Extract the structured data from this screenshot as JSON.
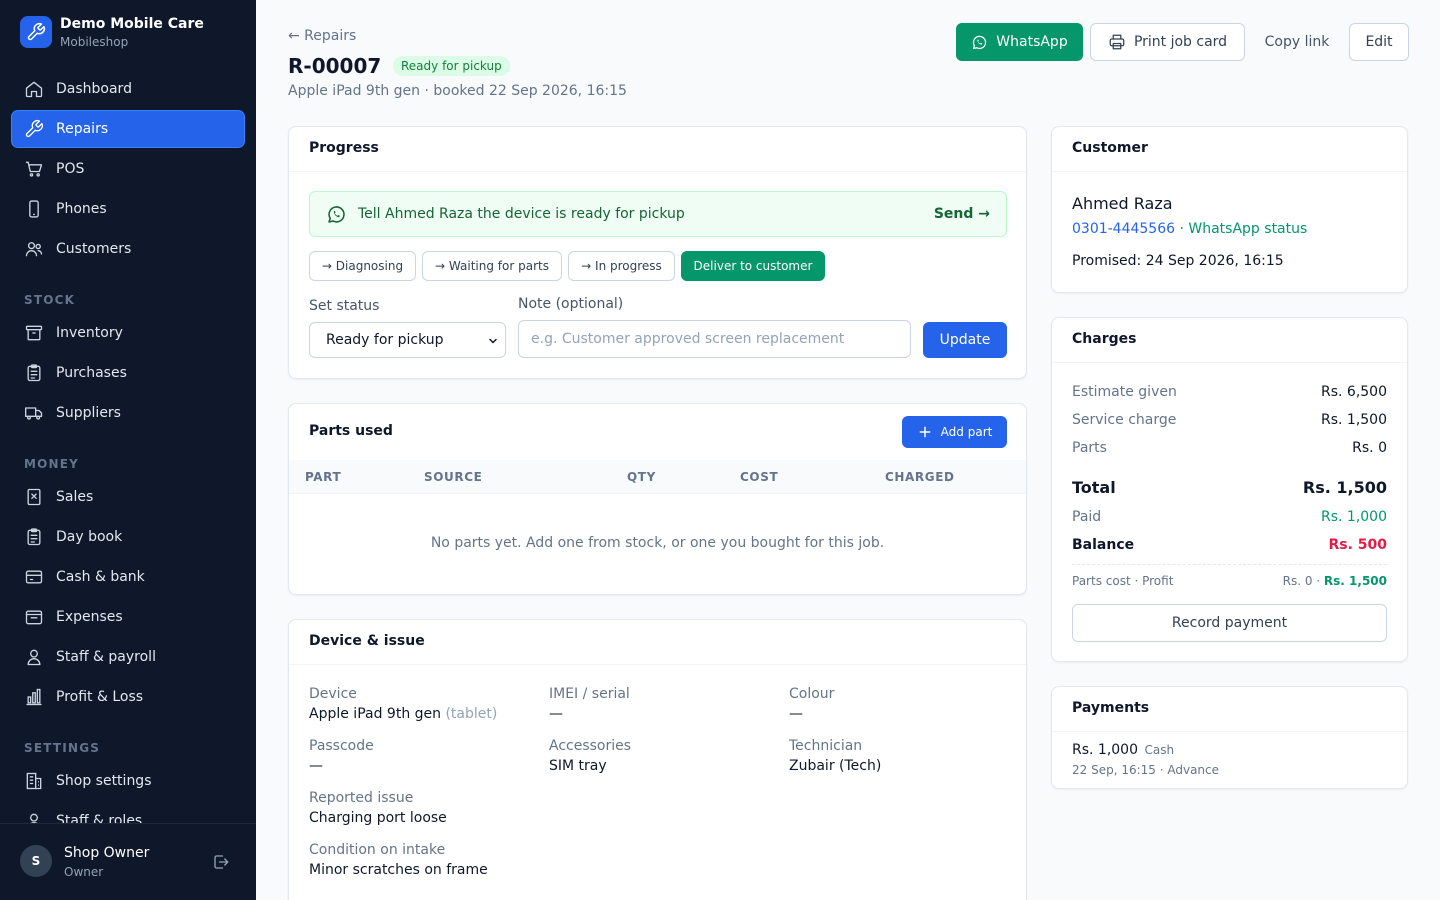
{
  "brand": {
    "name": "Demo Mobile Care",
    "subtitle": "Mobileshop",
    "color": "#2563eb"
  },
  "sidebar": {
    "items": [
      {
        "label": "Dashboard",
        "icon": "home-icon",
        "active": false
      },
      {
        "label": "Repairs",
        "icon": "wrench-icon",
        "active": true
      },
      {
        "label": "POS",
        "icon": "cart-icon",
        "active": false
      },
      {
        "label": "Phones",
        "icon": "phone-icon",
        "active": false
      },
      {
        "label": "Customers",
        "icon": "users-icon",
        "active": false
      }
    ],
    "sections": [
      {
        "title": "STOCK",
        "items": [
          {
            "label": "Inventory",
            "icon": "archive-icon"
          },
          {
            "label": "Purchases",
            "icon": "clipboard-icon"
          },
          {
            "label": "Suppliers",
            "icon": "truck-icon"
          }
        ]
      },
      {
        "title": "MONEY",
        "items": [
          {
            "label": "Sales",
            "icon": "receipt-icon"
          },
          {
            "label": "Day book",
            "icon": "book-icon"
          },
          {
            "label": "Cash & bank",
            "icon": "card-icon"
          },
          {
            "label": "Expenses",
            "icon": "wallet-icon"
          },
          {
            "label": "Staff & payroll",
            "icon": "person-icon"
          },
          {
            "label": "Profit & Loss",
            "icon": "bar-chart-icon"
          }
        ]
      },
      {
        "title": "SETTINGS",
        "items": [
          {
            "label": "Shop settings",
            "icon": "building-icon"
          },
          {
            "label": "Staff & roles",
            "icon": "person-icon"
          }
        ]
      }
    ],
    "user": {
      "initial": "S",
      "name": "Shop Owner",
      "role": "Owner"
    }
  },
  "header": {
    "back_label": "← Repairs",
    "job_id": "R-00007",
    "status": "Ready for pickup",
    "subtitle": "Apple iPad 9th gen · booked 22 Sep 2026, 16:15",
    "buttons": {
      "whatsapp": "WhatsApp",
      "print": "Print job card",
      "copy": "Copy link",
      "edit": "Edit"
    }
  },
  "progress": {
    "title": "Progress",
    "banner_text": "Tell Ahmed Raza the device is ready for pickup",
    "banner_action": "Send →",
    "chips": [
      "→ Diagnosing",
      "→ Waiting for parts",
      "→ In progress",
      "Deliver to customer"
    ],
    "set_status_label": "Set status",
    "set_status_value": "Ready for pickup",
    "note_label": "Note (optional)",
    "note_placeholder": "e.g. Customer approved screen replacement",
    "note_value": "",
    "update_label": "Update"
  },
  "parts": {
    "title": "Parts used",
    "add_label": "Add part",
    "columns": [
      "PART",
      "SOURCE",
      "QTY",
      "COST",
      "CHARGED"
    ],
    "rows": [],
    "empty_text": "No parts yet. Add one from stock, or one you bought for this job."
  },
  "device": {
    "title": "Device & issue",
    "device_label": "Device",
    "device_value": "Apple iPad 9th gen",
    "device_type": "(tablet)",
    "imei_label": "IMEI / serial",
    "imei_value": "—",
    "colour_label": "Colour",
    "colour_value": "—",
    "passcode_label": "Passcode",
    "passcode_value": "—",
    "accessories_label": "Accessories",
    "accessories_value": "SIM tray",
    "technician_label": "Technician",
    "technician_value": "Zubair (Tech)",
    "issue_label": "Reported issue",
    "issue_value": "Charging port loose",
    "condition_label": "Condition on intake",
    "condition_value": "Minor scratches on frame"
  },
  "customer": {
    "title": "Customer",
    "name": "Ahmed Raza",
    "phone": "0301-4445566",
    "separator": " · ",
    "whatsapp_status": "WhatsApp status",
    "promised": "Promised: 24 Sep 2026, 16:15"
  },
  "charges": {
    "title": "Charges",
    "estimate_label": "Estimate given",
    "estimate_value": "Rs. 6,500",
    "service_label": "Service charge",
    "service_value": "Rs. 1,500",
    "parts_label": "Parts",
    "parts_value": "Rs. 0",
    "total_label": "Total",
    "total_value": "Rs. 1,500",
    "paid_label": "Paid",
    "paid_value": "Rs. 1,000",
    "balance_label": "Balance",
    "balance_value": "Rs. 500",
    "cost_profit_label": "Parts cost · Profit",
    "parts_cost_value": "Rs. 0",
    "cost_profit_sep": " · ",
    "profit_value": "Rs. 1,500",
    "record_payment_label": "Record payment"
  },
  "payments": {
    "title": "Payments",
    "items": [
      {
        "amount": "Rs. 1,000",
        "method": "Cash",
        "meta": "22 Sep, 16:15 · Advance"
      }
    ]
  },
  "colors": {
    "primary": "#2563eb",
    "success": "#059669",
    "danger": "#e11d48",
    "sidebar_bg": "#0f172a"
  }
}
